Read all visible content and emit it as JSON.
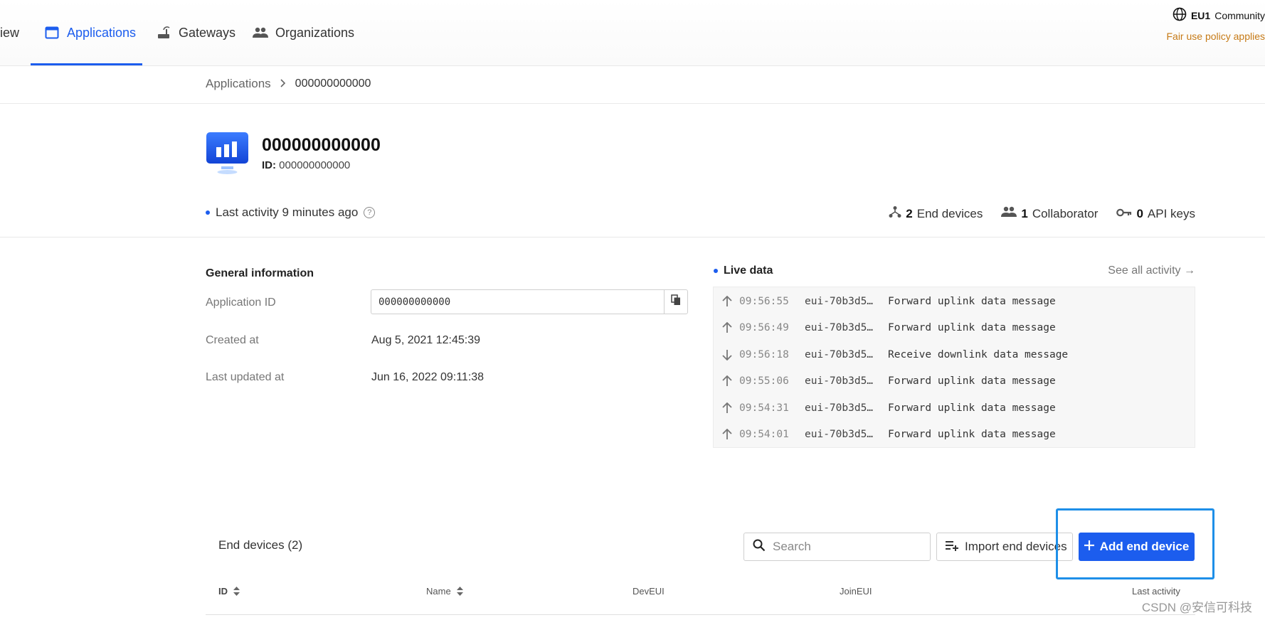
{
  "nav": {
    "items": [
      {
        "label": "iew",
        "icon": "overview-icon"
      },
      {
        "label": "Applications",
        "icon": "application-window-icon",
        "active": true
      },
      {
        "label": "Gateways",
        "icon": "gateway-router-icon"
      },
      {
        "label": "Organizations",
        "icon": "organization-people-icon"
      }
    ],
    "cluster": {
      "region": "EU1",
      "plan": "Community",
      "notice": "Fair use policy applies"
    }
  },
  "breadcrumb": {
    "parent": "Applications",
    "current": "000000000000"
  },
  "app": {
    "title": "000000000000",
    "id_label": "ID:",
    "id_value": "000000000000",
    "last_activity": "Last activity 9 minutes ago",
    "stats": [
      {
        "count": "2",
        "label": "End devices",
        "icon": "end-devices-icon"
      },
      {
        "count": "1",
        "label": "Collaborator",
        "icon": "collaborators-icon"
      },
      {
        "count": "0",
        "label": "API keys",
        "icon": "key-icon"
      }
    ]
  },
  "general": {
    "title": "General information",
    "app_id_label": "Application ID",
    "app_id_value": "000000000000",
    "created_label": "Created at",
    "created_value": "Aug 5, 2021 12:45:39",
    "updated_label": "Last updated at",
    "updated_value": "Jun 16, 2022 09:11:38"
  },
  "live": {
    "title": "Live data",
    "see_all": "See all activity →",
    "rows": [
      {
        "dir": "up",
        "time": "09:56:55",
        "eui": "eui-70b3d5…",
        "msg": "Forward uplink data message"
      },
      {
        "dir": "up",
        "time": "09:56:49",
        "eui": "eui-70b3d5…",
        "msg": "Forward uplink data message"
      },
      {
        "dir": "down",
        "time": "09:56:18",
        "eui": "eui-70b3d5…",
        "msg": "Receive downlink data message"
      },
      {
        "dir": "up",
        "time": "09:55:06",
        "eui": "eui-70b3d5…",
        "msg": "Forward uplink data message"
      },
      {
        "dir": "up",
        "time": "09:54:31",
        "eui": "eui-70b3d5…",
        "msg": "Forward uplink data message"
      },
      {
        "dir": "up",
        "time": "09:54:01",
        "eui": "eui-70b3d5…",
        "msg": "Forward uplink data message"
      }
    ]
  },
  "end_devices": {
    "title": "End devices (2)",
    "search_placeholder": "Search",
    "import_label": "Import end devices",
    "add_label": "Add end device",
    "columns": {
      "id": "ID",
      "name": "Name",
      "deveui": "DevEUI",
      "joineui": "JoinEUI",
      "last_activity": "Last activity"
    }
  },
  "watermark": "CSDN @安信可科技",
  "colors": {
    "accent": "#1c5dee",
    "warning": "#c67a16",
    "highlight": "#1e8fe8"
  }
}
